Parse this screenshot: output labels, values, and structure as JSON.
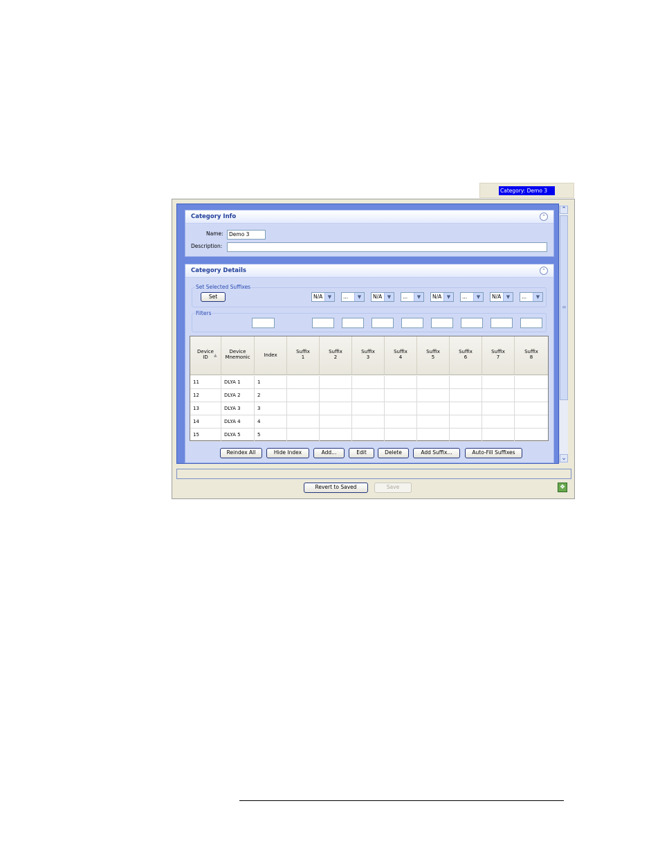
{
  "tab": {
    "active_label": "Category: Demo 3"
  },
  "category_info": {
    "title": "Category Info",
    "name_label": "Name:",
    "name_value": "Demo 3",
    "description_label": "Description:",
    "description_value": ""
  },
  "category_details": {
    "title": "Category Details",
    "set_group_title": "Set Selected Suffixes",
    "set_button": "Set",
    "suffix_selects": [
      "N/A",
      "...",
      "N/A",
      "...",
      "N/A",
      "...",
      "N/A",
      "..."
    ],
    "filters_title": "Filters"
  },
  "table": {
    "columns": [
      {
        "line1": "Device",
        "line2": "ID"
      },
      {
        "line1": "Device",
        "line2": "Mnemonic"
      },
      {
        "line1": "Index",
        "line2": ""
      },
      {
        "line1": "Suffix",
        "line2": "1"
      },
      {
        "line1": "Suffix",
        "line2": "2"
      },
      {
        "line1": "Suffix",
        "line2": "3"
      },
      {
        "line1": "Suffix",
        "line2": "4"
      },
      {
        "line1": "Suffix",
        "line2": "5"
      },
      {
        "line1": "Suffix",
        "line2": "6"
      },
      {
        "line1": "Suffix",
        "line2": "7"
      },
      {
        "line1": "Suffix",
        "line2": "8"
      }
    ],
    "rows": [
      [
        "11",
        "DLYA   1",
        "1",
        "",
        "",
        "",
        "",
        "",
        "",
        "",
        ""
      ],
      [
        "12",
        "DLYA   2",
        "2",
        "",
        "",
        "",
        "",
        "",
        "",
        "",
        ""
      ],
      [
        "13",
        "DLYA   3",
        "3",
        "",
        "",
        "",
        "",
        "",
        "",
        "",
        ""
      ],
      [
        "14",
        "DLYA   4",
        "4",
        "",
        "",
        "",
        "",
        "",
        "",
        "",
        ""
      ],
      [
        "15",
        "DLYA   5",
        "5",
        "",
        "",
        "",
        "",
        "",
        "",
        "",
        ""
      ]
    ]
  },
  "actions": {
    "reindex_all": "Reindex All",
    "hide_index": "Hide Index",
    "add": "Add...",
    "edit": "Edit",
    "delete": "Delete",
    "add_suffix": "Add Suffix...",
    "auto_fill": "Auto-Fill Suffixes"
  },
  "footer": {
    "revert": "Revert to Saved",
    "save": "Save"
  },
  "colors": {
    "frame_blue": "#6b87de",
    "panel_fill": "#cfd9f6",
    "header_text": "#22409a",
    "active_tab": "#0000f0"
  }
}
